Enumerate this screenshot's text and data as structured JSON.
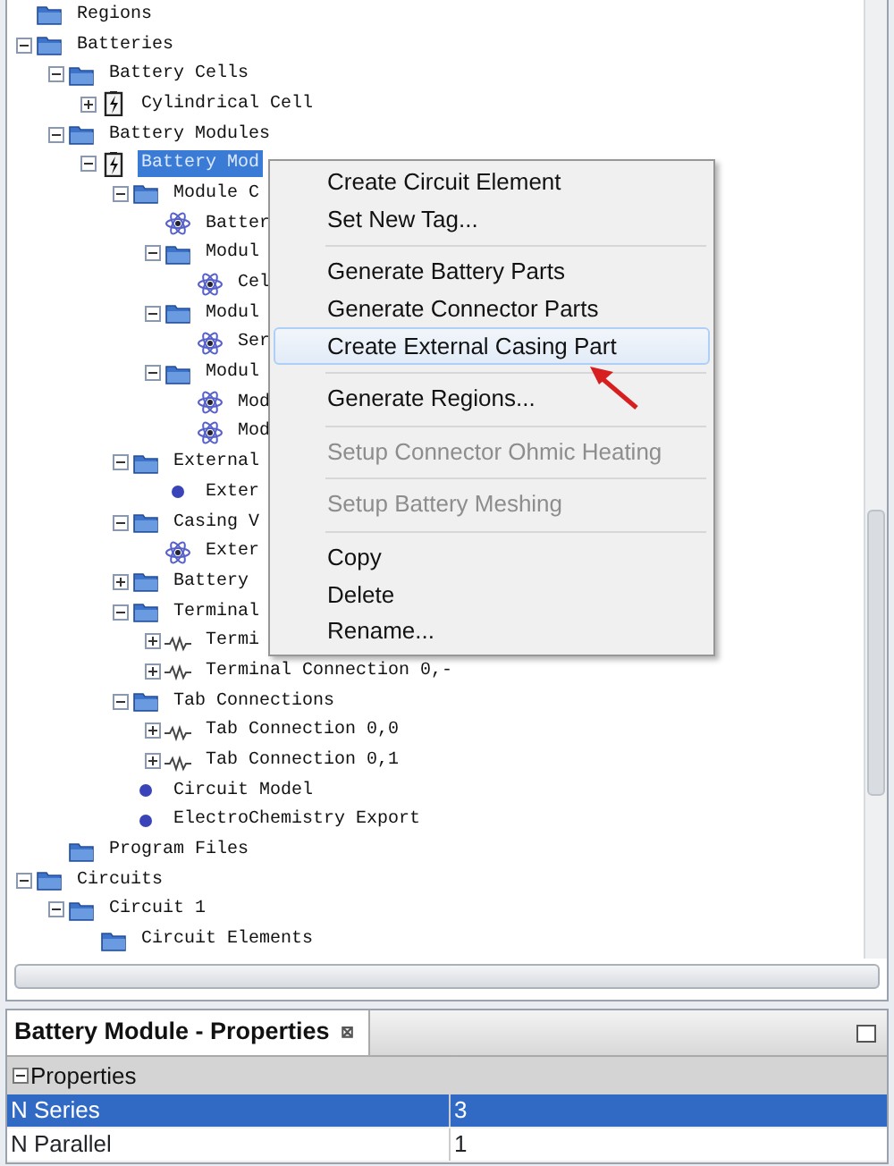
{
  "tree": [
    {
      "label": "Regions",
      "kind": "folder",
      "selected": false
    },
    {
      "label": "Batteries",
      "kind": "folder",
      "expanded": true,
      "selected": false,
      "children": [
        {
          "label": "Battery Cells",
          "kind": "folder",
          "expanded": true,
          "selected": false,
          "children": [
            {
              "label": "Cylindrical Cell",
              "kind": "battery",
              "expanded": false,
              "selected": false
            }
          ]
        },
        {
          "label": "Battery Modules",
          "kind": "folder",
          "expanded": true,
          "selected": false,
          "children": [
            {
              "label": "Battery Mod",
              "kind": "battery",
              "expanded": true,
              "selected": true,
              "children": [
                {
                  "label": "Module C",
                  "kind": "folder",
                  "expanded": true,
                  "selected": false,
                  "children": [
                    {
                      "label": "Batter",
                      "kind": "circuit",
                      "selected": false
                    },
                    {
                      "label": "Modul",
                      "kind": "folder",
                      "expanded": true,
                      "selected": false,
                      "children": [
                        {
                          "label": "Cel",
                          "kind": "circuit",
                          "selected": false
                        }
                      ]
                    },
                    {
                      "label": "Modul",
                      "kind": "folder",
                      "expanded": true,
                      "selected": false,
                      "children": [
                        {
                          "label": "Ser",
                          "kind": "circuit",
                          "selected": false
                        }
                      ]
                    },
                    {
                      "label": "Modul",
                      "kind": "folder",
                      "expanded": true,
                      "selected": false,
                      "children": [
                        {
                          "label": "Mod",
                          "kind": "circuit",
                          "selected": false
                        },
                        {
                          "label": "Mod",
                          "kind": "circuit",
                          "selected": false
                        }
                      ]
                    }
                  ]
                },
                {
                  "label": "External",
                  "kind": "folder",
                  "expanded": true,
                  "selected": false,
                  "children": [
                    {
                      "label": "Exter",
                      "kind": "dot",
                      "selected": false
                    }
                  ]
                },
                {
                  "label": "Casing V",
                  "kind": "folder",
                  "expanded": true,
                  "selected": false,
                  "children": [
                    {
                      "label": "Exter",
                      "kind": "circuit",
                      "selected": false
                    }
                  ]
                },
                {
                  "label": "Battery",
                  "kind": "folder",
                  "expanded": false,
                  "selected": false
                },
                {
                  "label": "Terminal",
                  "kind": "folder",
                  "expanded": true,
                  "selected": false,
                  "children": [
                    {
                      "label": "Termi",
                      "kind": "resistor",
                      "expanded": false,
                      "selected": false
                    },
                    {
                      "label": "Terminal Connection 0,-",
                      "kind": "resistor",
                      "expanded": false,
                      "selected": false
                    }
                  ]
                },
                {
                  "label": "Tab Connections",
                  "kind": "folder",
                  "expanded": true,
                  "selected": false,
                  "children": [
                    {
                      "label": "Tab Connection 0,0",
                      "kind": "resistor",
                      "expanded": false,
                      "selected": false
                    },
                    {
                      "label": "Tab Connection 0,1",
                      "kind": "resistor",
                      "expanded": false,
                      "selected": false
                    }
                  ]
                },
                {
                  "label": "Circuit Model",
                  "kind": "dot",
                  "selected": false
                },
                {
                  "label": "ElectroChemistry Export",
                  "kind": "dot",
                  "selected": false
                }
              ]
            }
          ]
        },
        {
          "label": "Program Files",
          "kind": "folder",
          "selected": false
        }
      ]
    },
    {
      "label": "Circuits",
      "kind": "folder",
      "expanded": true,
      "selected": false,
      "children": [
        {
          "label": "Circuit 1",
          "kind": "folder",
          "expanded": true,
          "selected": false,
          "children": [
            {
              "label": "Circuit Elements",
              "kind": "folder",
              "selected": false
            }
          ]
        }
      ]
    }
  ],
  "context_menu": {
    "groups": [
      [
        {
          "label": "Create Circuit Element",
          "disabled": false,
          "highlighted": false
        },
        {
          "label": "Set New Tag...",
          "disabled": false,
          "highlighted": false
        }
      ],
      [
        {
          "label": "Generate Battery Parts",
          "disabled": false,
          "highlighted": false
        },
        {
          "label": "Generate Connector Parts",
          "disabled": false,
          "highlighted": false
        },
        {
          "label": "Create External Casing Part",
          "disabled": false,
          "highlighted": true
        }
      ],
      [
        {
          "label": "Generate Regions...",
          "disabled": false,
          "highlighted": false
        }
      ],
      [
        {
          "label": "Setup Connector Ohmic Heating",
          "disabled": true,
          "highlighted": false
        }
      ],
      [
        {
          "label": "Setup Battery Meshing",
          "disabled": true,
          "highlighted": false
        }
      ],
      [
        {
          "label": "Copy",
          "disabled": false,
          "highlighted": false
        },
        {
          "label": "Delete",
          "disabled": false,
          "highlighted": false
        },
        {
          "label": "Rename...",
          "disabled": false,
          "highlighted": false
        }
      ]
    ]
  },
  "properties_panel": {
    "title": "Battery Module - Properties",
    "close": "⊠",
    "group": {
      "label": "Properties",
      "expanded": true
    },
    "rows": [
      {
        "name": "N Series",
        "value": "3",
        "selected": true
      },
      {
        "name": "N Parallel",
        "value": "1",
        "selected": false
      }
    ]
  }
}
